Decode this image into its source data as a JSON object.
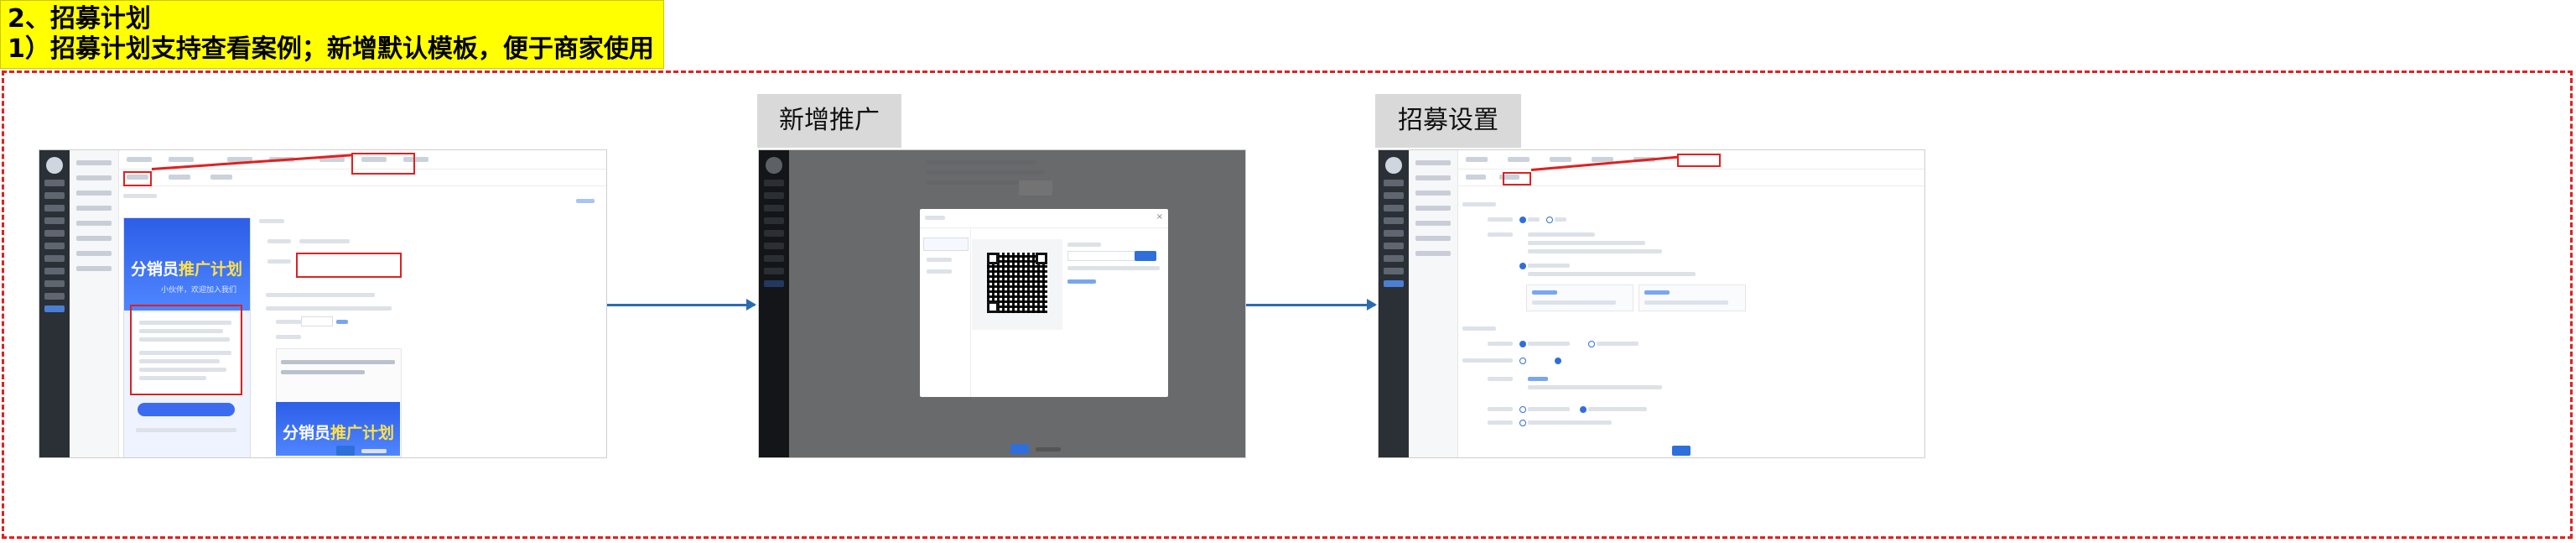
{
  "header": {
    "line1": "2、招募计划",
    "line2": "1）招募计划支持查看案例；新增默认模板，便于商家使用"
  },
  "steps": [
    {
      "label": ""
    },
    {
      "label": "新增推广"
    },
    {
      "label": "招募设置"
    }
  ],
  "screen1": {
    "phone_title_prefix": "分销员",
    "phone_title_highlight": "推广计划",
    "phone_subtitle": "小伙伴，欢迎加入我们",
    "editor_title_prefix": "分销员",
    "editor_title_highlight": "推广计划"
  },
  "colors": {
    "highlight": "#ffff00",
    "frame": "#e02020",
    "arrow": "#2b6cb0",
    "accent": "#2f6fdc"
  }
}
